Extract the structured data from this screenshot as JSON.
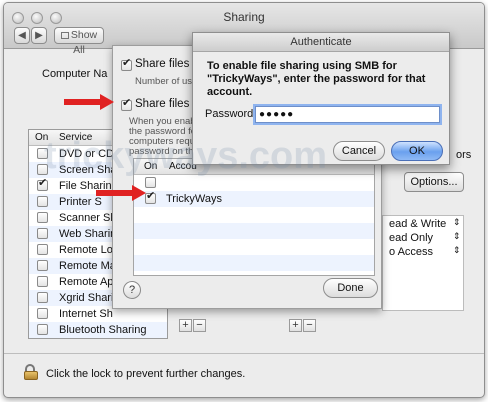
{
  "window": {
    "title": "Sharing",
    "show_all": "Show All",
    "nav_back": "◀",
    "nav_fwd": "▶"
  },
  "main": {
    "computer_name_label": "Computer Na",
    "services_header": {
      "on": "On",
      "service": "Service"
    },
    "services": [
      {
        "name": "DVD or CD",
        "on": false
      },
      {
        "name": "Screen Sha",
        "on": false
      },
      {
        "name": "File Sharing",
        "on": true
      },
      {
        "name": "Printer S",
        "on": false
      },
      {
        "name": "Scanner Sh",
        "on": false
      },
      {
        "name": "Web Sharing",
        "on": false
      },
      {
        "name": "Remote Lo",
        "on": false
      },
      {
        "name": "Remote Ma",
        "on": false
      },
      {
        "name": "Remote Ap",
        "on": false
      },
      {
        "name": "Xgrid Shari",
        "on": false
      },
      {
        "name": "Internet Sh",
        "on": false
      },
      {
        "name": "Bluetooth Sharing",
        "on": false
      }
    ],
    "right_fragment": "ors",
    "options_button": "Options...",
    "permissions": [
      "ead & Write",
      "ead Only",
      "o Access"
    ],
    "plus": "+",
    "minus": "−",
    "help": "?",
    "lock_text": "Click the lock to prevent further changes."
  },
  "sheet": {
    "share_afp_label": "Share files an",
    "afp_info": "Number of use",
    "share_smb_label": "Share files an",
    "smb_info_lines": [
      "When you enab",
      "the password fo",
      "computers requ",
      "password on thi"
    ],
    "table_header": {
      "on": "On",
      "account": "Accou"
    },
    "accounts": [
      {
        "name": "TrickyWays",
        "on": true
      }
    ],
    "help": "?",
    "done_button": "Done"
  },
  "auth": {
    "title": "Authenticate",
    "message": "To enable file sharing using SMB for \"TrickyWays\", enter the password for that account.",
    "password_label": "Password:",
    "password_value": "●●●●●",
    "cancel_button": "Cancel",
    "ok_button": "OK"
  },
  "watermark": "trickyways.com",
  "colors": {
    "arrow": "#e02222",
    "ok_button": "#6aa0ee",
    "selection": "#edf3fe"
  }
}
